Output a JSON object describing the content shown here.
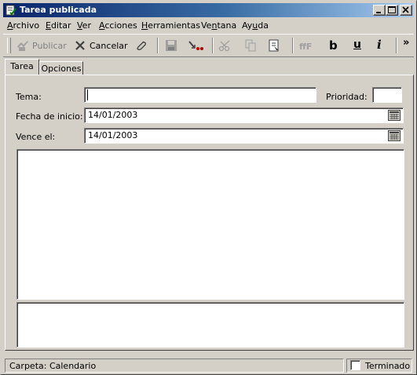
{
  "window": {
    "title": "Tarea publicada",
    "colors": {
      "titlebar_start": "#0a246a",
      "titlebar_end": "#a6caf0",
      "face": "#d4d0c8"
    }
  },
  "menu": {
    "archivo": {
      "accel": "A",
      "rest": "rchivo"
    },
    "editar": {
      "accel": "E",
      "rest": "ditar"
    },
    "ver": {
      "accel": "V",
      "rest": "er"
    },
    "acciones": {
      "accel": "A",
      "rest": "cciones"
    },
    "herramientas": {
      "accel": "H",
      "rest": "erramientas"
    },
    "ventana": {
      "pre": "Ve",
      "accel": "n",
      "rest": "tana"
    },
    "ayuda": {
      "pre": "Ay",
      "accel": "u",
      "rest": "da"
    }
  },
  "toolbar": {
    "publicar_label": "Publicar",
    "cancelar_label": "Cancelar",
    "bold_label": "b",
    "underline_label": "u",
    "italic_label": "i",
    "overflow_label": "»"
  },
  "tabs": [
    {
      "label": "Tarea",
      "selected": true
    },
    {
      "label": "Opciones",
      "selected": false
    }
  ],
  "form": {
    "tema_label": "Tema:",
    "tema_value": "",
    "prioridad_label": "Prioridad:",
    "prioridad_value": "",
    "fecha_inicio_label": "Fecha de inicio:",
    "fecha_inicio_value": "14/01/2003",
    "vence_label": "Vence el:",
    "vence_value": "14/01/2003"
  },
  "status": {
    "carpeta": "Carpeta: Calendario",
    "terminado_label": "Terminado",
    "terminado_checked": false
  }
}
